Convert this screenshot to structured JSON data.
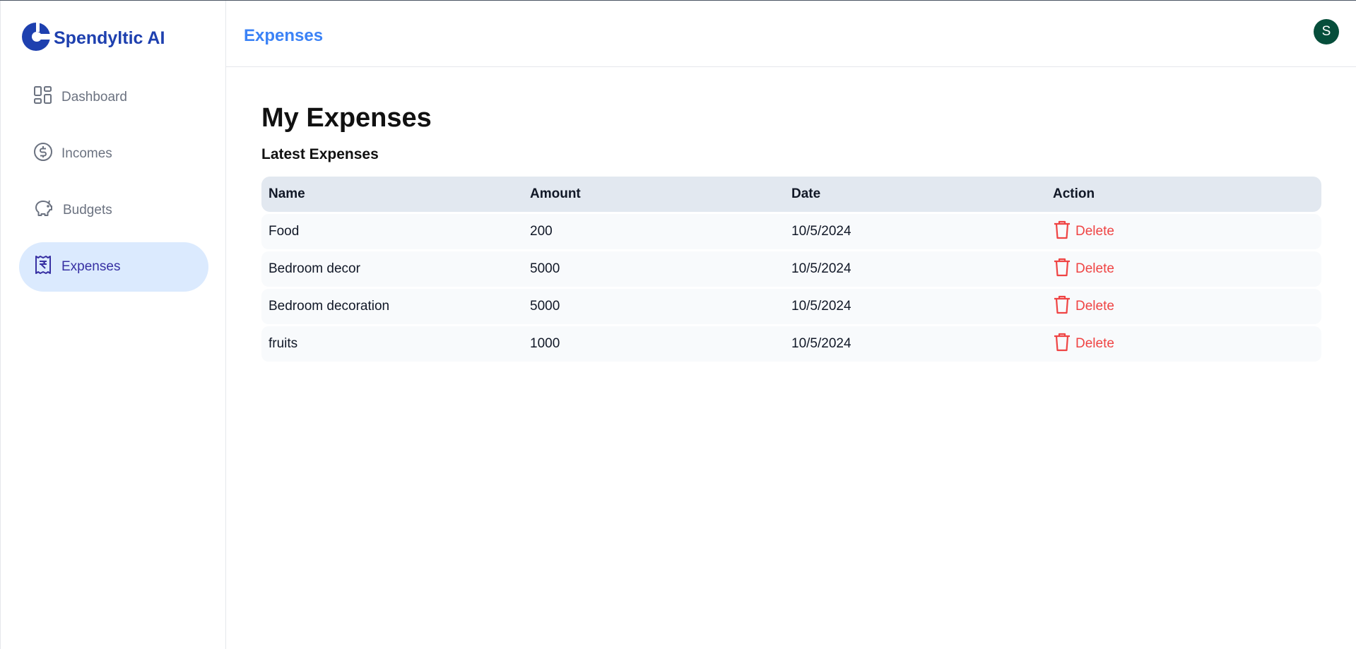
{
  "app": {
    "name": "Spendyltic AI"
  },
  "sidebar": {
    "items": [
      {
        "label": "Dashboard",
        "icon": "dashboard-icon",
        "active": false
      },
      {
        "label": "Incomes",
        "icon": "dollar-circle-icon",
        "active": false
      },
      {
        "label": "Budgets",
        "icon": "piggy-bank-icon",
        "active": false
      },
      {
        "label": "Expenses",
        "icon": "receipt-rupee-icon",
        "active": true
      }
    ]
  },
  "header": {
    "title": "Expenses",
    "avatar_initial": "S"
  },
  "main": {
    "title": "My Expenses",
    "subtitle": "Latest Expenses",
    "table": {
      "columns": [
        "Name",
        "Amount",
        "Date",
        "Action"
      ],
      "rows": [
        {
          "name": "Food",
          "amount": "200",
          "date": "10/5/2024",
          "action": "Delete"
        },
        {
          "name": "Bedroom decor",
          "amount": "5000",
          "date": "10/5/2024",
          "action": "Delete"
        },
        {
          "name": "Bedroom decoration",
          "amount": "5000",
          "date": "10/5/2024",
          "action": "Delete"
        },
        {
          "name": "fruits",
          "amount": "1000",
          "date": "10/5/2024",
          "action": "Delete"
        }
      ]
    }
  },
  "colors": {
    "brand": "#1e40af",
    "accent": "#3b82f6",
    "danger": "#ef4444",
    "active_bg": "#dbeafe"
  }
}
